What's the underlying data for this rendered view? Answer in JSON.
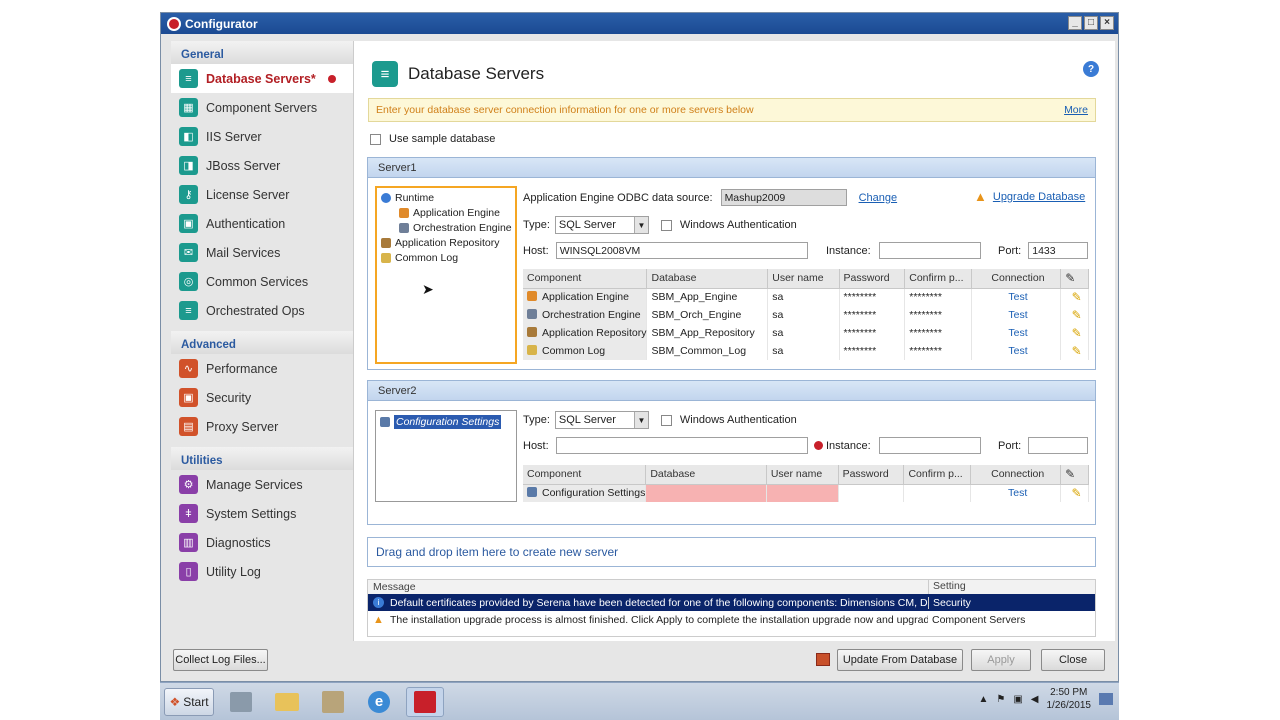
{
  "window": {
    "title": "Configurator",
    "controls": [
      "_",
      "□",
      "×"
    ]
  },
  "nav": {
    "groups": [
      {
        "label": "General",
        "items": [
          {
            "label": "Database Servers*",
            "icon": "database-icon",
            "active": true
          },
          {
            "label": "Component Servers",
            "icon": "component-servers-icon"
          },
          {
            "label": "IIS Server",
            "icon": "iis-server-icon"
          },
          {
            "label": "JBoss Server",
            "icon": "jboss-server-icon"
          },
          {
            "label": "License Server",
            "icon": "key-icon"
          },
          {
            "label": "Authentication",
            "icon": "lock-icon"
          },
          {
            "label": "Mail Services",
            "icon": "mail-icon"
          },
          {
            "label": "Common Services",
            "icon": "common-services-icon"
          },
          {
            "label": "Orchestrated Ops",
            "icon": "orchestrated-ops-icon"
          }
        ]
      },
      {
        "label": "Advanced",
        "items": [
          {
            "label": "Performance",
            "icon": "performance-icon"
          },
          {
            "label": "Security",
            "icon": "lock-icon"
          },
          {
            "label": "Proxy Server",
            "icon": "proxy-server-icon"
          }
        ]
      },
      {
        "label": "Utilities",
        "items": [
          {
            "label": "Manage Services",
            "icon": "gears-icon"
          },
          {
            "label": "System Settings",
            "icon": "settings-icon"
          },
          {
            "label": "Diagnostics",
            "icon": "chart-icon"
          },
          {
            "label": "Utility Log",
            "icon": "log-icon"
          }
        ]
      }
    ]
  },
  "page": {
    "title": "Database Servers",
    "info": "Enter your database server connection information for one or more servers below",
    "more": "More",
    "use_sample": "Use sample database"
  },
  "server1": {
    "title": "Server1",
    "tree": [
      "Runtime",
      "Application Engine",
      "Orchestration Engine",
      "Application Repository",
      "Common Log"
    ],
    "odbc_label": "Application Engine ODBC data source:",
    "odbc_value": "Mashup2009",
    "change": "Change",
    "upgrade": "Upgrade Database",
    "type_label": "Type:",
    "type_value": "SQL Server",
    "win_auth": "Windows Authentication",
    "host_label": "Host:",
    "host_value": "WINSQL2008VM",
    "instance_label": "Instance:",
    "instance_value": "",
    "port_label": "Port:",
    "port_value": "1433",
    "columns": [
      "Component",
      "Database",
      "User name",
      "Password",
      "Confirm p...",
      "Connection"
    ],
    "rows": [
      {
        "component": "Application Engine",
        "database": "SBM_App_Engine",
        "user": "sa",
        "password": "********",
        "confirm": "********",
        "connection": "Test"
      },
      {
        "component": "Orchestration Engine",
        "database": "SBM_Orch_Engine",
        "user": "sa",
        "password": "********",
        "confirm": "********",
        "connection": "Test"
      },
      {
        "component": "Application Repository",
        "database": "SBM_App_Repository",
        "user": "sa",
        "password": "********",
        "confirm": "********",
        "connection": "Test"
      },
      {
        "component": "Common Log",
        "database": "SBM_Common_Log",
        "user": "sa",
        "password": "********",
        "confirm": "********",
        "connection": "Test"
      }
    ]
  },
  "server2": {
    "title": "Server2",
    "tree": [
      "Configuration Settings"
    ],
    "type_label": "Type:",
    "type_value": "SQL Server",
    "win_auth": "Windows Authentication",
    "host_label": "Host:",
    "host_value": "",
    "instance_label": "Instance:",
    "port_label": "Port:",
    "columns": [
      "Component",
      "Database",
      "User name",
      "Password",
      "Confirm p...",
      "Connection"
    ],
    "rows": [
      {
        "component": "Configuration Settings",
        "database": "",
        "user": "",
        "password": "",
        "confirm": "",
        "connection": "Test"
      }
    ]
  },
  "drop_zone": "Drag  and drop item here to create new server",
  "messages": {
    "col_message": "Message",
    "col_setting": "Setting",
    "rows": [
      {
        "text": "Default certificates provided by Serena have been detected for one of the following components: Dimensions CM, Dimens",
        "setting": "Security",
        "kind": "info"
      },
      {
        "text": "The installation upgrade process is almost finished. Click Apply to complete the installation upgrade now and upgrade the c",
        "setting": "Component Servers",
        "kind": "warning"
      }
    ]
  },
  "buttons": {
    "collect_logs": "Collect Log Files...",
    "update_db": "Update From Database",
    "apply": "Apply",
    "close": "Close"
  },
  "taskbar": {
    "start": "Start",
    "time": "2:50 PM",
    "date": "1/26/2015"
  },
  "colors": {
    "accent": "#2b5aa0",
    "active_nav": "#b21f24",
    "teal": "#1c9a8e",
    "selection": "#0a246a"
  }
}
